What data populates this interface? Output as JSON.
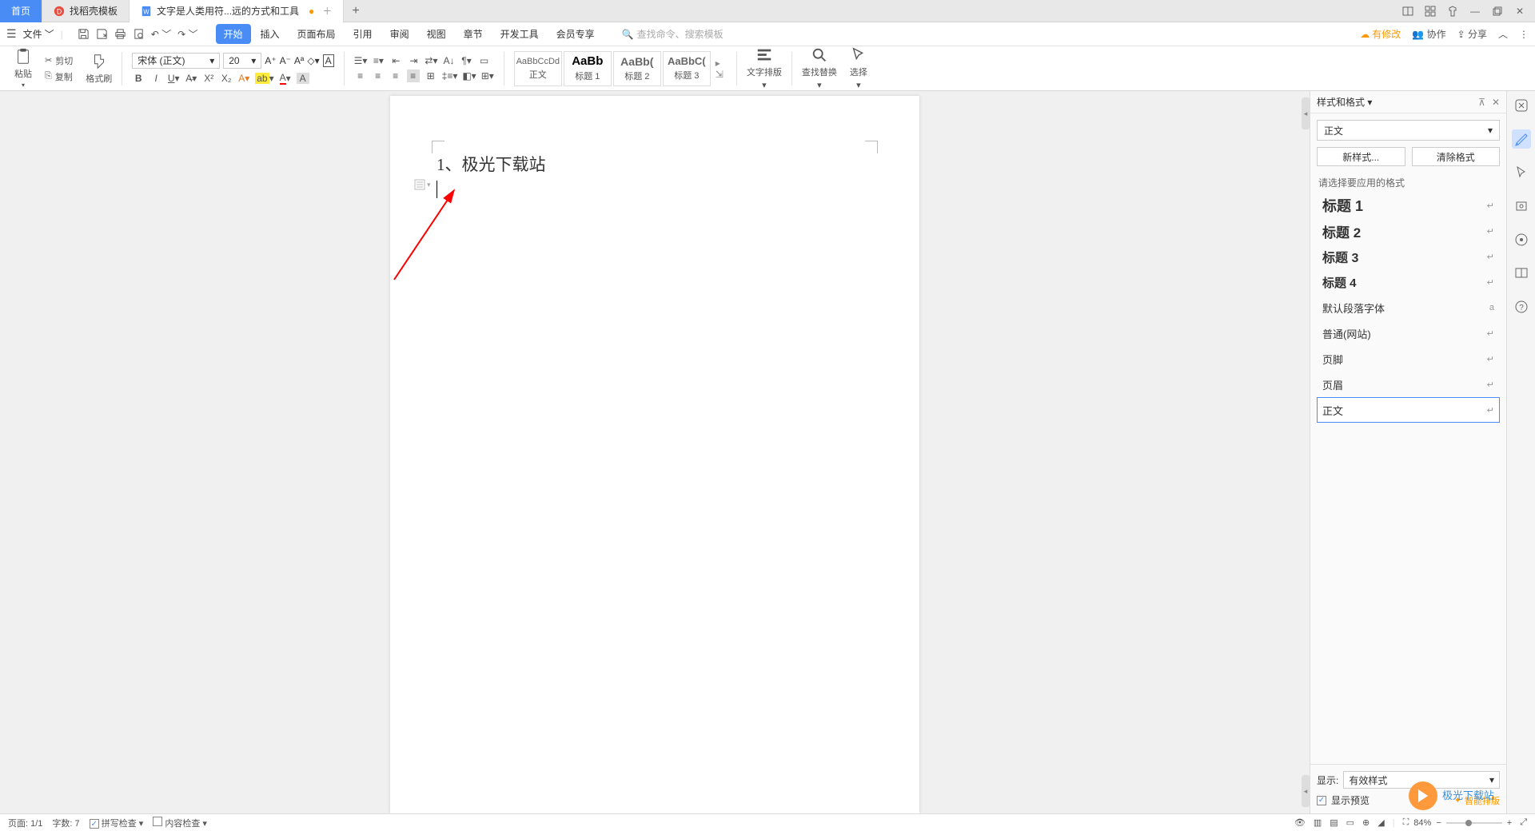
{
  "tabs": {
    "home": "首页",
    "template": "找稻壳模板",
    "doc": "文字是人类用符...远的方式和工具"
  },
  "menu": {
    "file": "文件",
    "items": [
      "开始",
      "插入",
      "页面布局",
      "引用",
      "审阅",
      "视图",
      "章节",
      "开发工具",
      "会员专享"
    ],
    "search_placeholder": "查找命令、搜索模板",
    "cloud": "有修改",
    "coop": "协作",
    "share": "分享"
  },
  "ribbon": {
    "paste": "粘贴",
    "cut": "剪切",
    "copy": "复制",
    "format_painter": "格式刷",
    "font_name": "宋体 (正文)",
    "font_size": "20",
    "styles": [
      {
        "preview": "AaBbCcDd",
        "label": "正文"
      },
      {
        "preview": "AaBb",
        "label": "标题 1"
      },
      {
        "preview": "AaBb(",
        "label": "标题 2"
      },
      {
        "preview": "AaBbC(",
        "label": "标题 3"
      }
    ],
    "text_layout": "文字排版",
    "find_replace": "查找替换",
    "select": "选择"
  },
  "document": {
    "line1": "1、极光下载站"
  },
  "style_panel": {
    "title": "样式和格式",
    "current": "正文",
    "new_style": "新样式...",
    "clear_format": "清除格式",
    "apply_label": "请选择要应用的格式",
    "items": [
      {
        "name": "标题 1",
        "cls": "h1"
      },
      {
        "name": "标题 2",
        "cls": "h2"
      },
      {
        "name": "标题 3",
        "cls": "h3"
      },
      {
        "name": "标题 4",
        "cls": "h4"
      },
      {
        "name": "默认段落字体",
        "cls": "normal",
        "mark": "a"
      },
      {
        "name": "普通(网站)",
        "cls": "normal"
      },
      {
        "name": "页脚",
        "cls": "normal"
      },
      {
        "name": "页眉",
        "cls": "normal"
      },
      {
        "name": "正文",
        "cls": "normal",
        "selected": true
      }
    ],
    "display_label": "显示:",
    "display_value": "有效样式",
    "preview_checkbox": "显示预览",
    "smart": "智能排版"
  },
  "status": {
    "page": "页面: 1/1",
    "words": "字数: 7",
    "spell": "拼写检查",
    "content": "内容检查",
    "zoom": "84%"
  },
  "watermark": "极光下载站"
}
